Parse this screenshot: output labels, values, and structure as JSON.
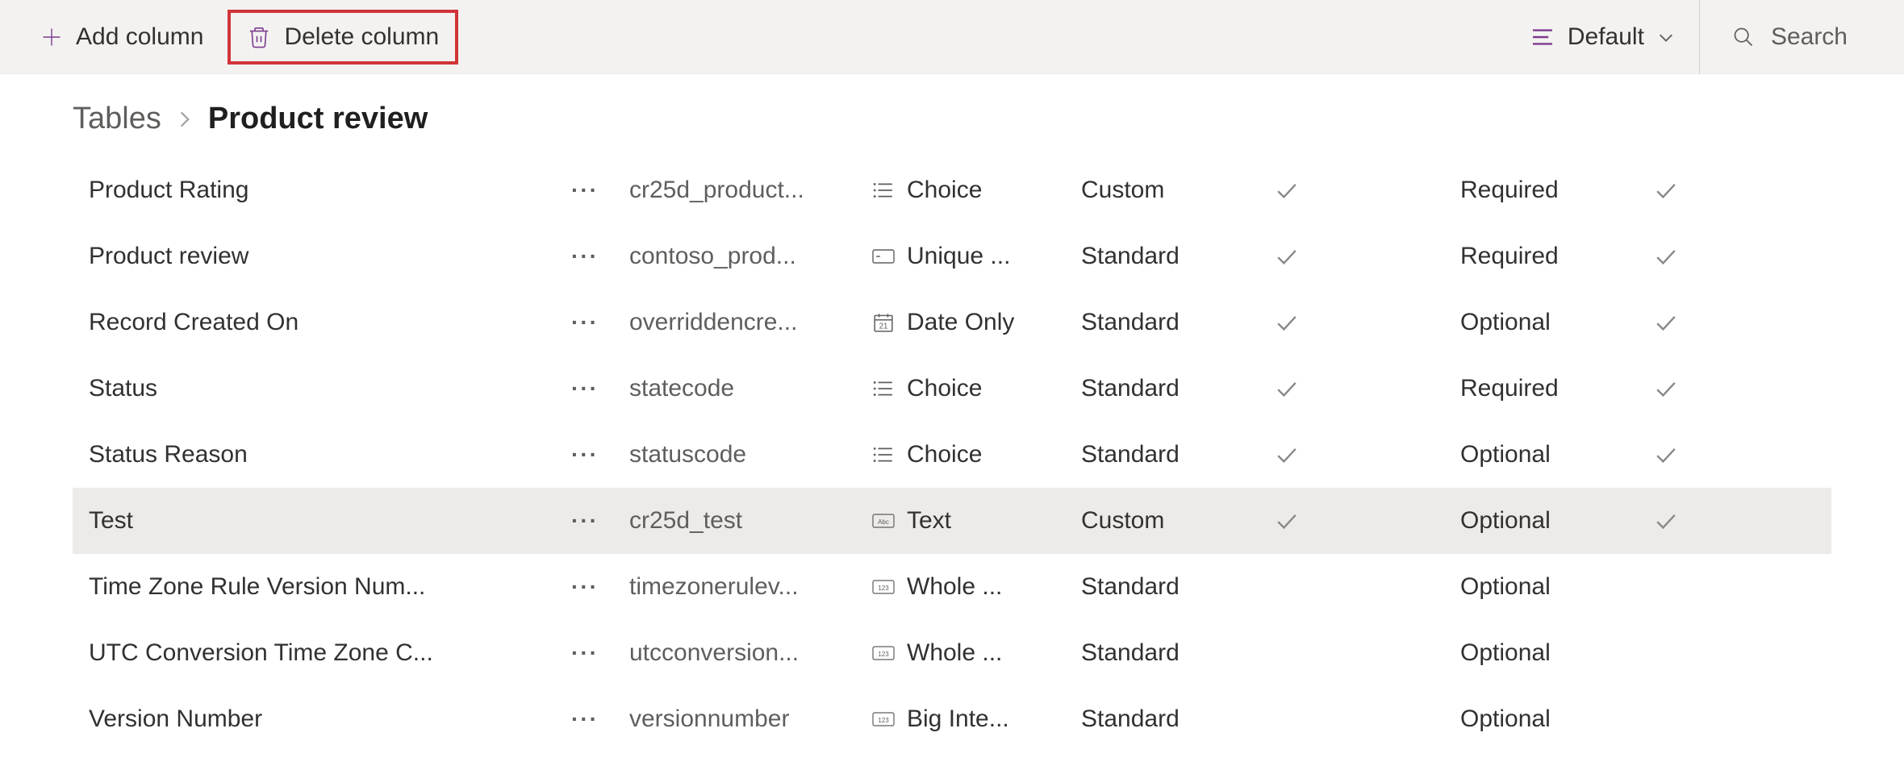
{
  "toolbar": {
    "add_column": "Add column",
    "delete_column": "Delete column",
    "view_label": "Default",
    "search_placeholder": "Search"
  },
  "breadcrumb": {
    "root": "Tables",
    "current": "Product review"
  },
  "rows": [
    {
      "display": "Product Rating",
      "logical": "cr25d_product...",
      "type": "Choice",
      "type_icon": "choice",
      "managed": "Custom",
      "check1": true,
      "required": "Required",
      "check2": true,
      "selected": false
    },
    {
      "display": "Product review",
      "logical": "contoso_prod...",
      "type": "Unique ...",
      "type_icon": "unique",
      "managed": "Standard",
      "check1": true,
      "required": "Required",
      "check2": true,
      "selected": false
    },
    {
      "display": "Record Created On",
      "logical": "overriddencre...",
      "type": "Date Only",
      "type_icon": "date",
      "managed": "Standard",
      "check1": true,
      "required": "Optional",
      "check2": true,
      "selected": false
    },
    {
      "display": "Status",
      "logical": "statecode",
      "type": "Choice",
      "type_icon": "choice",
      "managed": "Standard",
      "check1": true,
      "required": "Required",
      "check2": true,
      "selected": false
    },
    {
      "display": "Status Reason",
      "logical": "statuscode",
      "type": "Choice",
      "type_icon": "choice",
      "managed": "Standard",
      "check1": true,
      "required": "Optional",
      "check2": true,
      "selected": false
    },
    {
      "display": "Test",
      "logical": "cr25d_test",
      "type": "Text",
      "type_icon": "text",
      "managed": "Custom",
      "check1": true,
      "required": "Optional",
      "check2": true,
      "selected": true
    },
    {
      "display": "Time Zone Rule Version Num...",
      "logical": "timezonerulev...",
      "type": "Whole ...",
      "type_icon": "whole",
      "managed": "Standard",
      "check1": false,
      "required": "Optional",
      "check2": false,
      "selected": false
    },
    {
      "display": "UTC Conversion Time Zone C...",
      "logical": "utcconversion...",
      "type": "Whole ...",
      "type_icon": "whole",
      "managed": "Standard",
      "check1": false,
      "required": "Optional",
      "check2": false,
      "selected": false
    },
    {
      "display": "Version Number",
      "logical": "versionnumber",
      "type": "Big Inte...",
      "type_icon": "whole",
      "managed": "Standard",
      "check1": false,
      "required": "Optional",
      "check2": false,
      "selected": false
    }
  ]
}
